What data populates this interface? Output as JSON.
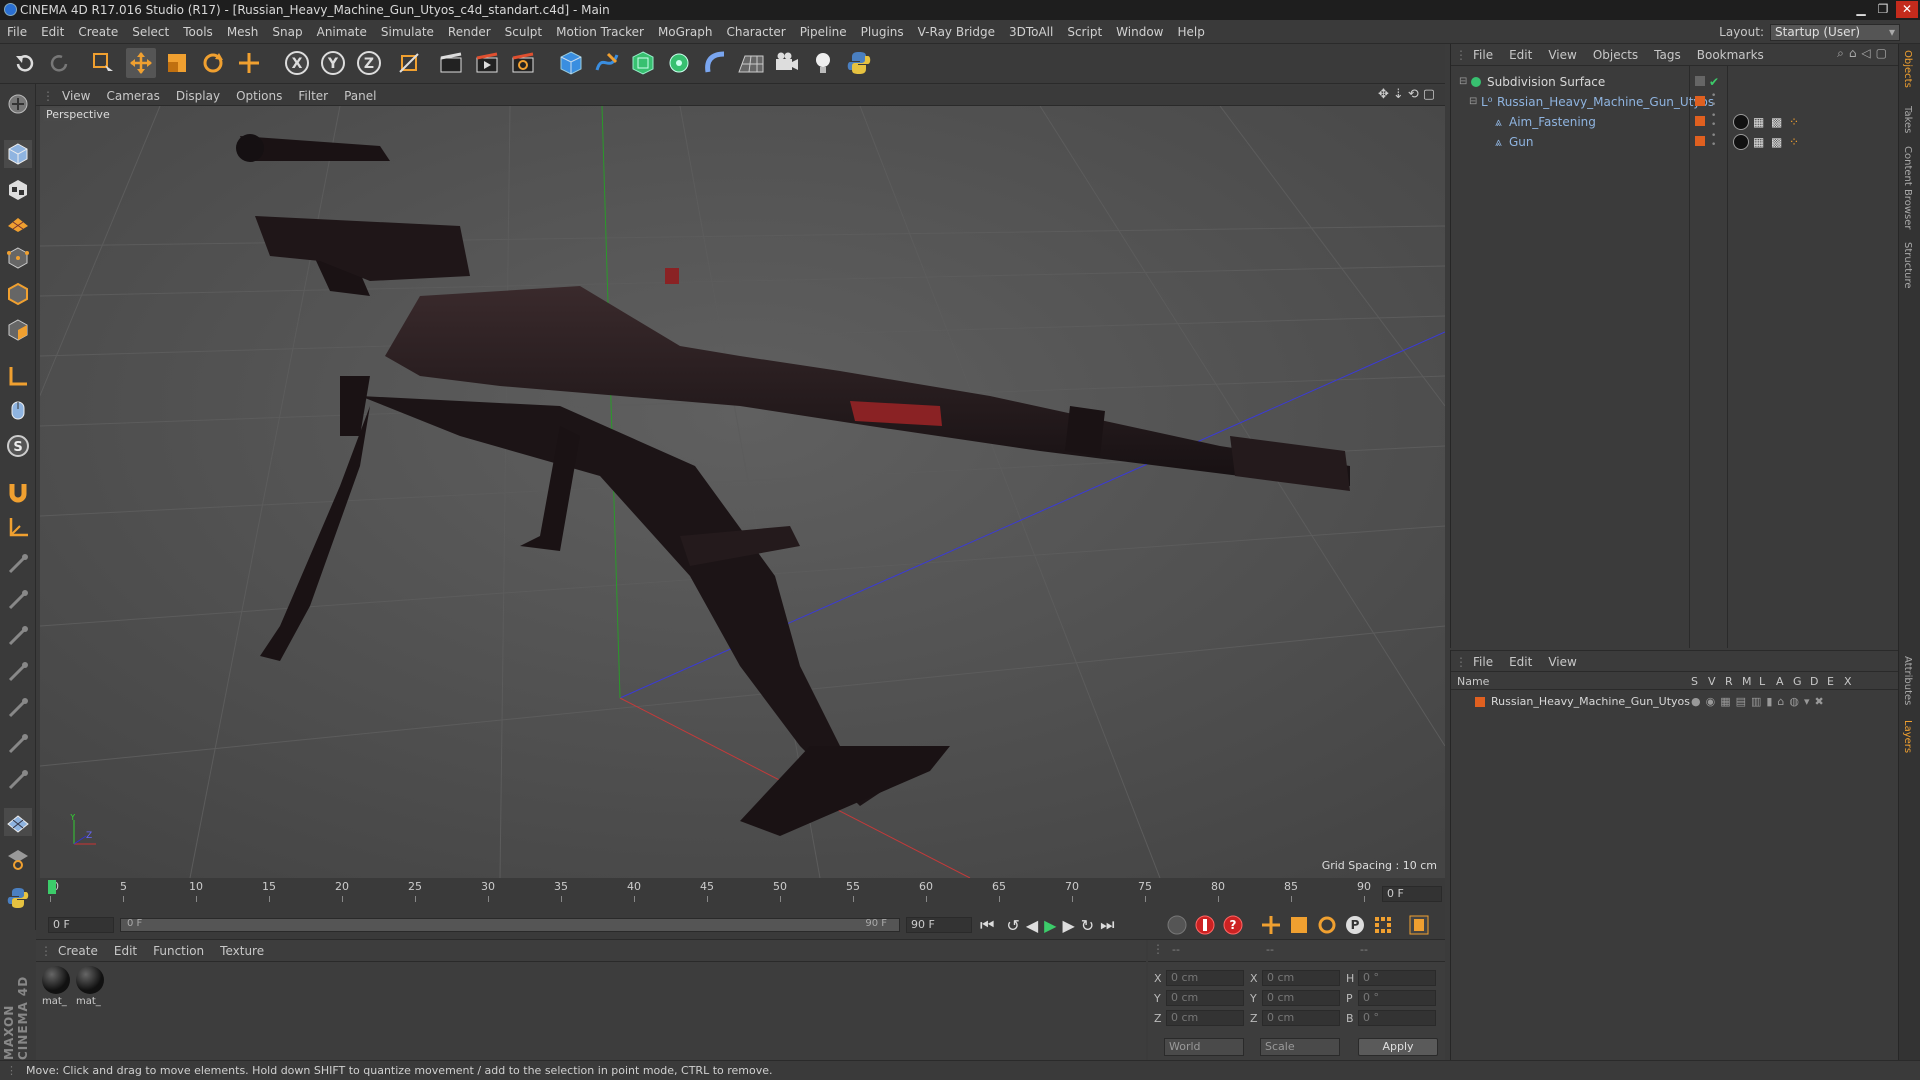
{
  "window": {
    "title": "CINEMA 4D R17.016 Studio (R17) - [Russian_Heavy_Machine_Gun_Utyos_c4d_standart.c4d] - Main",
    "minimize": "▁",
    "maximize": "❐",
    "close": "✕"
  },
  "menu": [
    "File",
    "Edit",
    "Create",
    "Select",
    "Tools",
    "Mesh",
    "Snap",
    "Animate",
    "Simulate",
    "Render",
    "Sculpt",
    "Motion Tracker",
    "MoGraph",
    "Character",
    "Pipeline",
    "Plugins",
    "V-Ray Bridge",
    "3DToAll",
    "Script",
    "Window",
    "Help"
  ],
  "layout": {
    "label": "Layout:",
    "value": "Startup (User)"
  },
  "toolbar": {
    "axis_x": "X",
    "axis_y": "Y",
    "axis_z": "Z",
    "accent": "#f0a030"
  },
  "viewport": {
    "menu": [
      "View",
      "Cameras",
      "Display",
      "Options",
      "Filter",
      "Panel"
    ],
    "camera_label": "Perspective",
    "grid_spacing": "Grid Spacing : 10 cm",
    "gizmo": {
      "y": "Y",
      "z": "Z"
    }
  },
  "timeline": {
    "ticks": [
      "0",
      "5",
      "10",
      "15",
      "20",
      "25",
      "30",
      "35",
      "40",
      "45",
      "50",
      "55",
      "60",
      "65",
      "70",
      "75",
      "80",
      "85",
      "90"
    ],
    "current_frame": "0 F",
    "start_field": "0 F",
    "range_start": "0 F",
    "range_end": "90 F",
    "end_field": "90 F",
    "max_frame": 90
  },
  "materials": {
    "menu": [
      "Create",
      "Edit",
      "Function",
      "Texture"
    ],
    "items": [
      {
        "label": "mat_"
      },
      {
        "label": "mat_"
      }
    ]
  },
  "coords": {
    "headers": [
      "--",
      "--",
      "--"
    ],
    "rows": [
      {
        "a": "X",
        "av": "0 cm",
        "b": "X",
        "bv": "0 cm",
        "c": "H",
        "cv": "0 °"
      },
      {
        "a": "Y",
        "av": "0 cm",
        "b": "Y",
        "bv": "0 cm",
        "c": "P",
        "cv": "0 °"
      },
      {
        "a": "Z",
        "av": "0 cm",
        "b": "Z",
        "bv": "0 cm",
        "c": "B",
        "cv": "0 °"
      }
    ],
    "mode": "World",
    "scale": "Scale",
    "apply": "Apply"
  },
  "objects": {
    "menu": [
      "File",
      "Edit",
      "View",
      "Objects",
      "Tags",
      "Bookmarks"
    ],
    "items": [
      {
        "name": "Subdivision Surface"
      },
      {
        "name": "Russian_Heavy_Machine_Gun_Utyos"
      },
      {
        "name": "Aim_Fastening"
      },
      {
        "name": "Gun"
      }
    ]
  },
  "layers": {
    "menu": [
      "File",
      "Edit",
      "View"
    ],
    "header_name": "Name",
    "flags": [
      "S",
      "V",
      "R",
      "M",
      "L",
      "A",
      "G",
      "D",
      "E",
      "X"
    ],
    "items": [
      {
        "name": "Russian_Heavy_Machine_Gun_Utyos",
        "color": "#e06020"
      }
    ]
  },
  "right_tabs": [
    "Objects",
    "Takes",
    "Content Browser",
    "Structure",
    "Attributes",
    "Layers"
  ],
  "status": "Move: Click and drag to move elements. Hold down SHIFT to quantize movement / add to the selection in point mode, CTRL to remove.",
  "brand": "MAXON CINEMA 4D"
}
